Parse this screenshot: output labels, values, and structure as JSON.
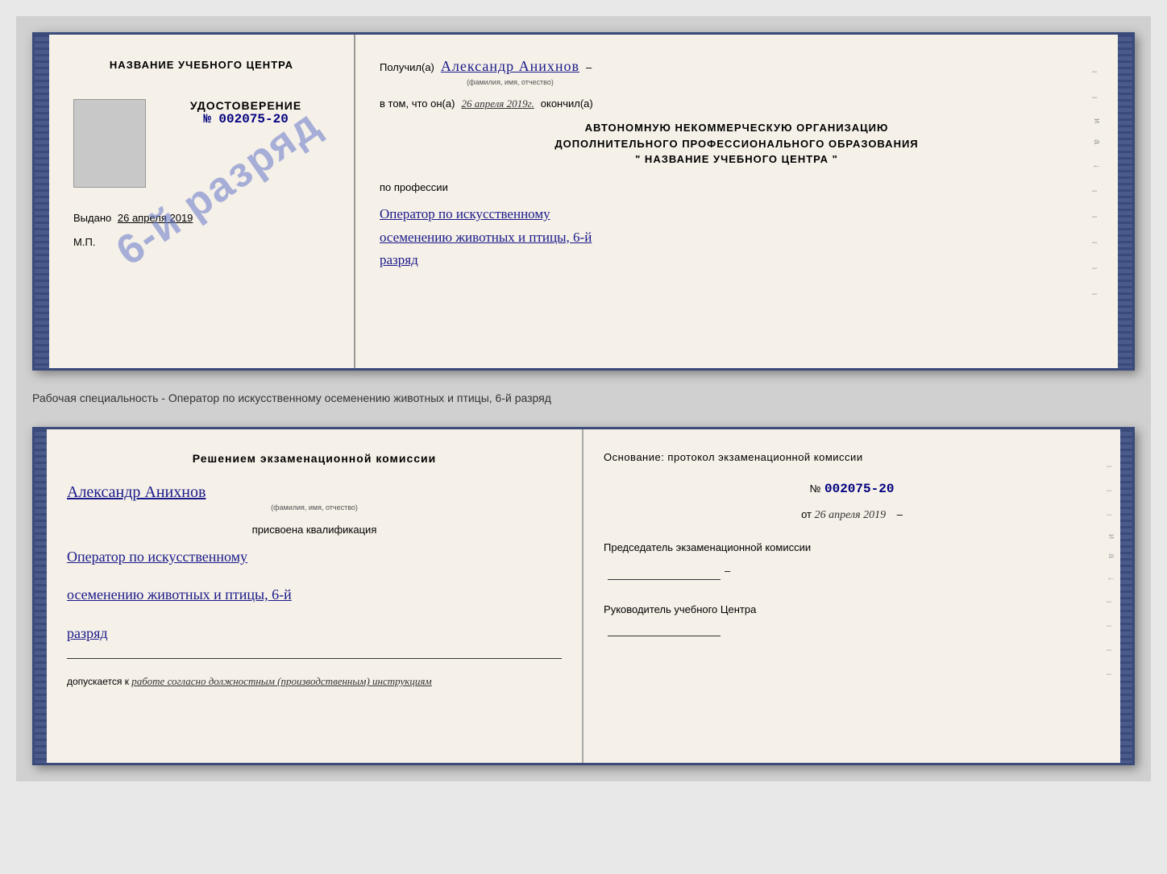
{
  "top_certificate": {
    "left": {
      "top_title": "НАЗВАНИЕ УЧЕБНОГО ЦЕНТРА",
      "udostoverenie_title": "УДОСТОВЕРЕНИЕ",
      "udost_number": "№ 002075-20",
      "vydano_label": "Выдано",
      "vydano_date": "26 апреля 2019",
      "mp_label": "М.П.",
      "stamp_text": "6-й разряд"
    },
    "right": {
      "poluchil_label": "Получил(а)",
      "recipient_name": "Александр Анихнов",
      "recipient_sub": "(фамилия, имя, отчество)",
      "vtom_label": "в том, что он(а)",
      "date_value": "26 апреля 2019г.",
      "okonchil_label": "окончил(а)",
      "org_line1": "АВТОНОМНУЮ НЕКОММЕРЧЕСКУЮ ОРГАНИЗАЦИЮ",
      "org_line2": "ДОПОЛНИТЕЛЬНОГО ПРОФЕССИОНАЛЬНОГО ОБРАЗОВАНИЯ",
      "org_line3": "\"    НАЗВАНИЕ УЧЕБНОГО ЦЕНТРА    \"",
      "po_professii": "по профессии",
      "profession_line1": "Оператор по искусственному",
      "profession_line2": "осеменению животных и птицы, 6-й",
      "profession_line3": "разряд"
    }
  },
  "subtitle": "Рабочая специальность - Оператор по искусственному осеменению животных и птицы, 6-й разряд",
  "bottom_qualification": {
    "left": {
      "resheniem_label": "Решением экзаменационной комиссии",
      "person_name": "Александр Анихнов",
      "person_sub": "(фамилия, имя, отчество)",
      "prisvoena_label": "присвоена квалификация",
      "qual_line1": "Оператор по искусственному",
      "qual_line2": "осеменению животных и птицы, 6-й",
      "qual_line3": "разряд",
      "dopuskaetsya_label": "допускается к",
      "work_text": "работе согласно должностным (производственным) инструкциям"
    },
    "right": {
      "osnovanie_label": "Основание: протокол экзаменационной комиссии",
      "number_prefix": "№",
      "number_value": "002075-20",
      "ot_label": "от",
      "ot_date": "26 апреля 2019",
      "predsedatel_label": "Председатель экзаменационной комиссии",
      "rukovoditel_label": "Руководитель учебного Центра"
    }
  }
}
